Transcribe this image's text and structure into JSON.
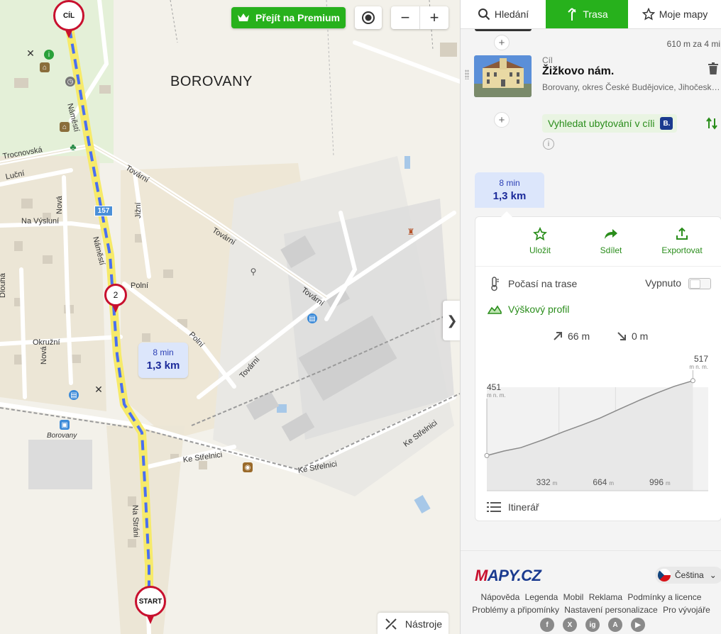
{
  "map": {
    "town_label": "BOROVANY",
    "station_label": "Borovany",
    "route_number": "157",
    "street_labels": [
      "Trocnovská",
      "Luční",
      "Na Výsluní",
      "Nová",
      "Tovární",
      "Jižní",
      "Polní",
      "Okružní",
      "Dlouhá",
      "Ke Střelnici",
      "Ke Střelnici",
      "Ke Střelnici",
      "Tovární",
      "Tovární",
      "Polní",
      "Náměstí",
      "Náměstí",
      "Na Stráni",
      "Nová",
      "Polní"
    ],
    "premium_label": "Přejít na Premium",
    "zoom_out": "−",
    "zoom_in": "+",
    "pin_end": "CÍL",
    "pin_mid": "2",
    "pin_start": "START",
    "route_bubble": {
      "time": "8 min",
      "distance": "1,3 km"
    },
    "tools_label": "Nástroje",
    "collapse_glyph": "❯"
  },
  "sidebar": {
    "tabs": [
      {
        "label": "Hledání",
        "icon": "search-icon"
      },
      {
        "label": "Trasa",
        "icon": "route-icon"
      },
      {
        "label": "Moje mapy",
        "icon": "star-icon"
      }
    ],
    "segment_distance": "610 m za 4 mi",
    "add_glyph": "+",
    "destination": {
      "label": "Cíl",
      "name": "Žižkovo nám.",
      "address": "Borovany, okres České Budějovice, Jihočeský kraj"
    },
    "accommodation_label": "Vyhledat ubytování v cíli",
    "booking_badge": "B.",
    "summary": {
      "time": "8 min",
      "distance": "1,3 km"
    },
    "actions": [
      {
        "label": "Uložit",
        "icon": "star-outline-icon"
      },
      {
        "label": "Sdílet",
        "icon": "share-icon"
      },
      {
        "label": "Exportovat",
        "icon": "export-icon"
      }
    ],
    "weather_label": "Počasí na trase",
    "weather_toggle_label": "Vypnuto",
    "elevation_label": "Výškový profil",
    "ascent": "66 m",
    "descent": "0 m",
    "elevation": {
      "start_alt": "451",
      "end_alt": "517",
      "unit": "m n. m.",
      "x_ticks": [
        "332",
        "664",
        "996"
      ],
      "x_unit": "m",
      "profile_m": [
        [
          0,
          451
        ],
        [
          100,
          455
        ],
        [
          200,
          458
        ],
        [
          332,
          465
        ],
        [
          450,
          472
        ],
        [
          560,
          478
        ],
        [
          664,
          484
        ],
        [
          780,
          492
        ],
        [
          900,
          500
        ],
        [
          996,
          506
        ],
        [
          1100,
          512
        ],
        [
          1210,
          517
        ]
      ],
      "distance_max": 1300
    },
    "itinerary_label": "Itinerář"
  },
  "footer": {
    "logo_parts": [
      "M",
      "APY.CZ"
    ],
    "language": "Čeština",
    "links_row1": [
      "Nápověda",
      "Legenda",
      "Mobil",
      "Reklama",
      "Podmínky a licence"
    ],
    "links_row2": [
      "Problémy a připomínky",
      "Nastavení personalizace",
      "Pro vývojáře"
    ],
    "socials": [
      "f",
      "X",
      "ig",
      "A",
      "▶"
    ]
  },
  "colors": {
    "brand_green": "#27b11c",
    "route_blue": "#4a6ff0",
    "pin_red": "#c8102e",
    "summary_bg": "#dce6fb"
  }
}
